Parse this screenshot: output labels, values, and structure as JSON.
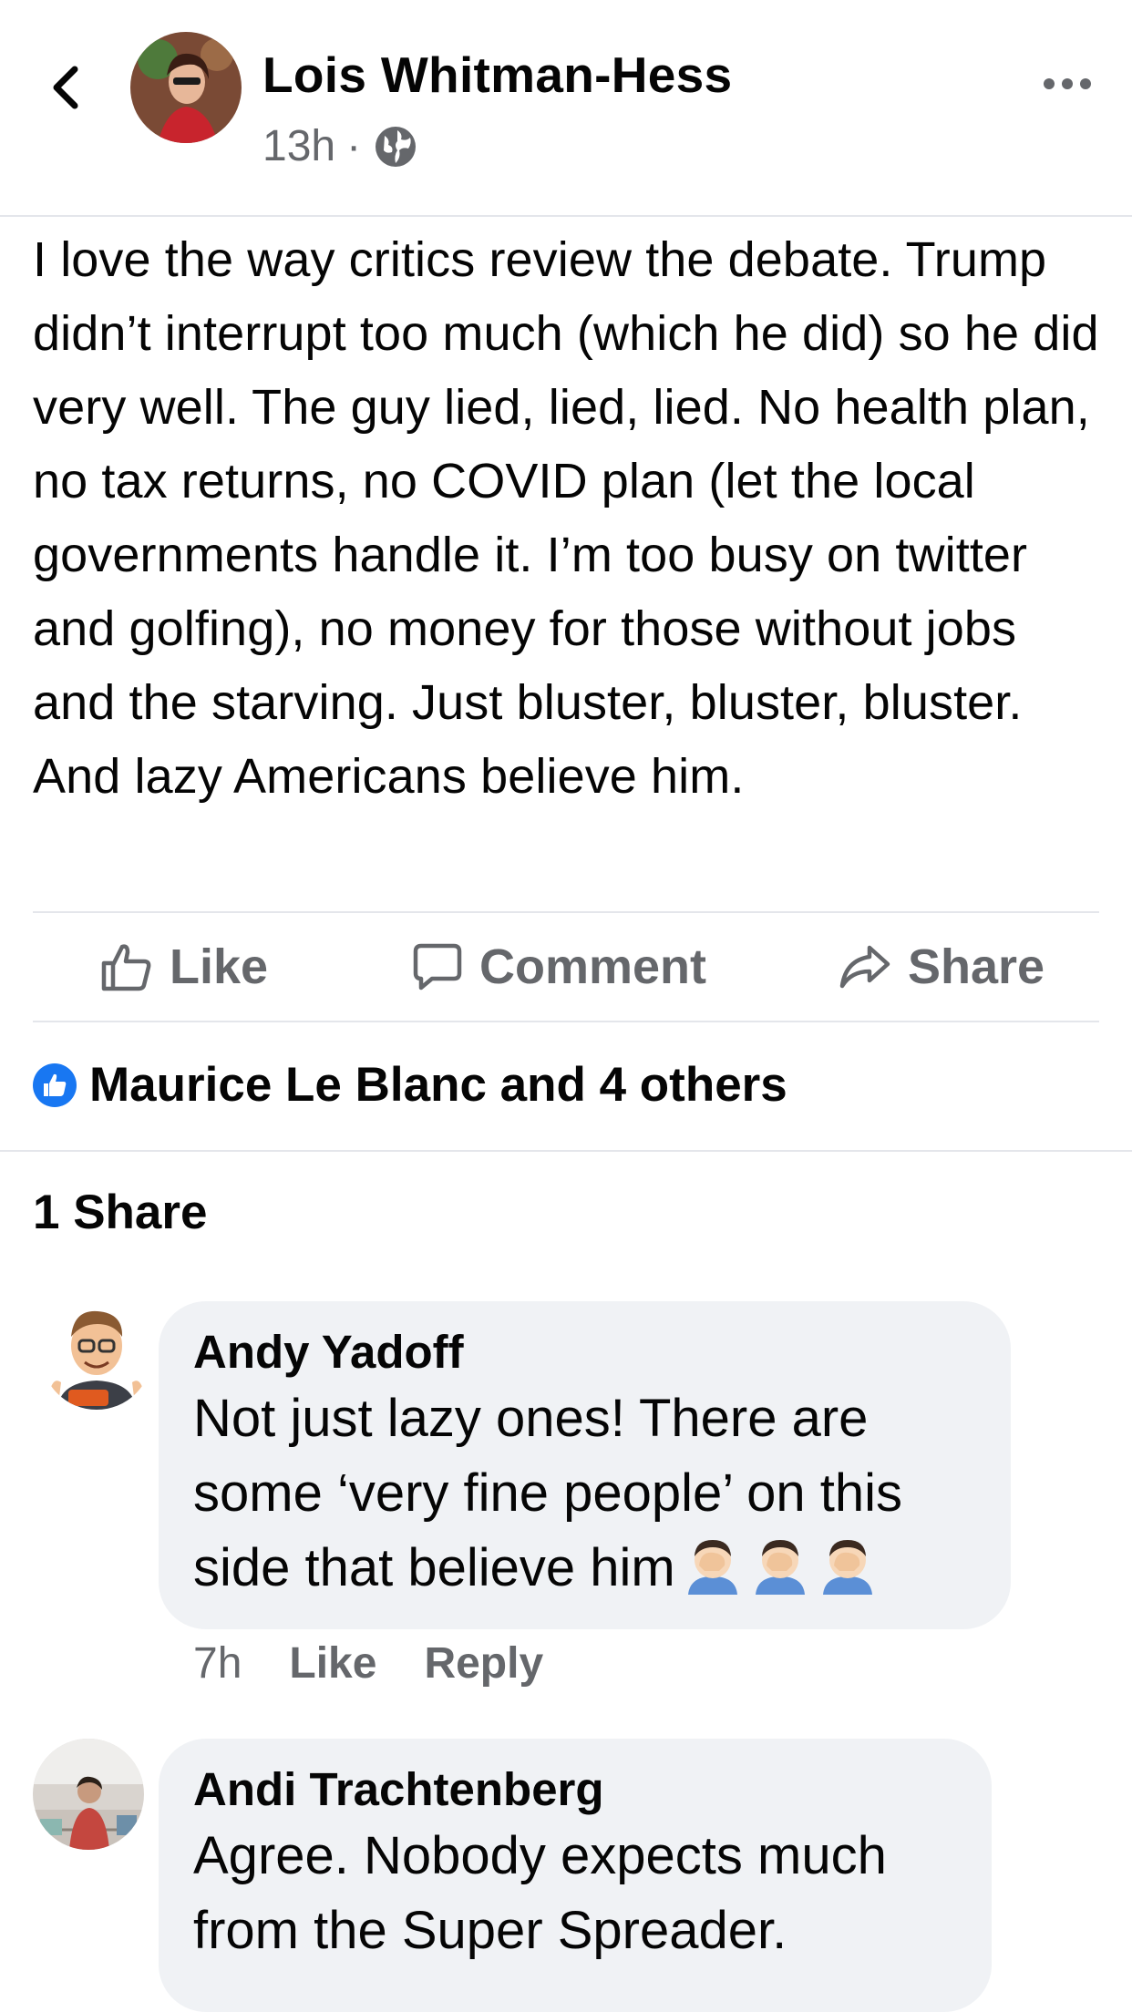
{
  "header": {
    "author": "Lois Whitman-Hess",
    "time": "13h",
    "separator": "·",
    "privacy_icon": "globe-icon",
    "back_icon": "chevron-left-icon",
    "more_icon": "more-horizontal-icon"
  },
  "post": {
    "text": "I love the way critics review the debate. Trump didn’t interrupt too much (which he did) so he did very well. The guy lied, lied, lied. No health plan, no tax returns, no COVID plan (let the local governments handle it. I’m too busy on twitter and golfing), no money for those without jobs and the starving. Just bluster, bluster, bluster. And lazy Americans believe him."
  },
  "actions": {
    "like": "Like",
    "comment": "Comment",
    "share": "Share"
  },
  "reactions": {
    "text": "Maurice Le Blanc and 4 others",
    "icon": "like-badge-icon",
    "color": "#1877f2"
  },
  "shares": {
    "text": "1 Share"
  },
  "comments": [
    {
      "author": "Andy Yadoff",
      "text": "Not just lazy ones! There are some ‘very fine people’ on this side that believe him",
      "emoji": "facepalm-emoji ×3",
      "time": "7h",
      "like": "Like",
      "reply": "Reply"
    },
    {
      "author": "Andi Trachtenberg",
      "text": "Agree. Nobody expects much from the Super Spreader."
    }
  ],
  "colors": {
    "secondary_text": "#65676b",
    "bubble": "#f0f2f5",
    "divider": "#e4e6eb",
    "accent": "#1877f2"
  }
}
